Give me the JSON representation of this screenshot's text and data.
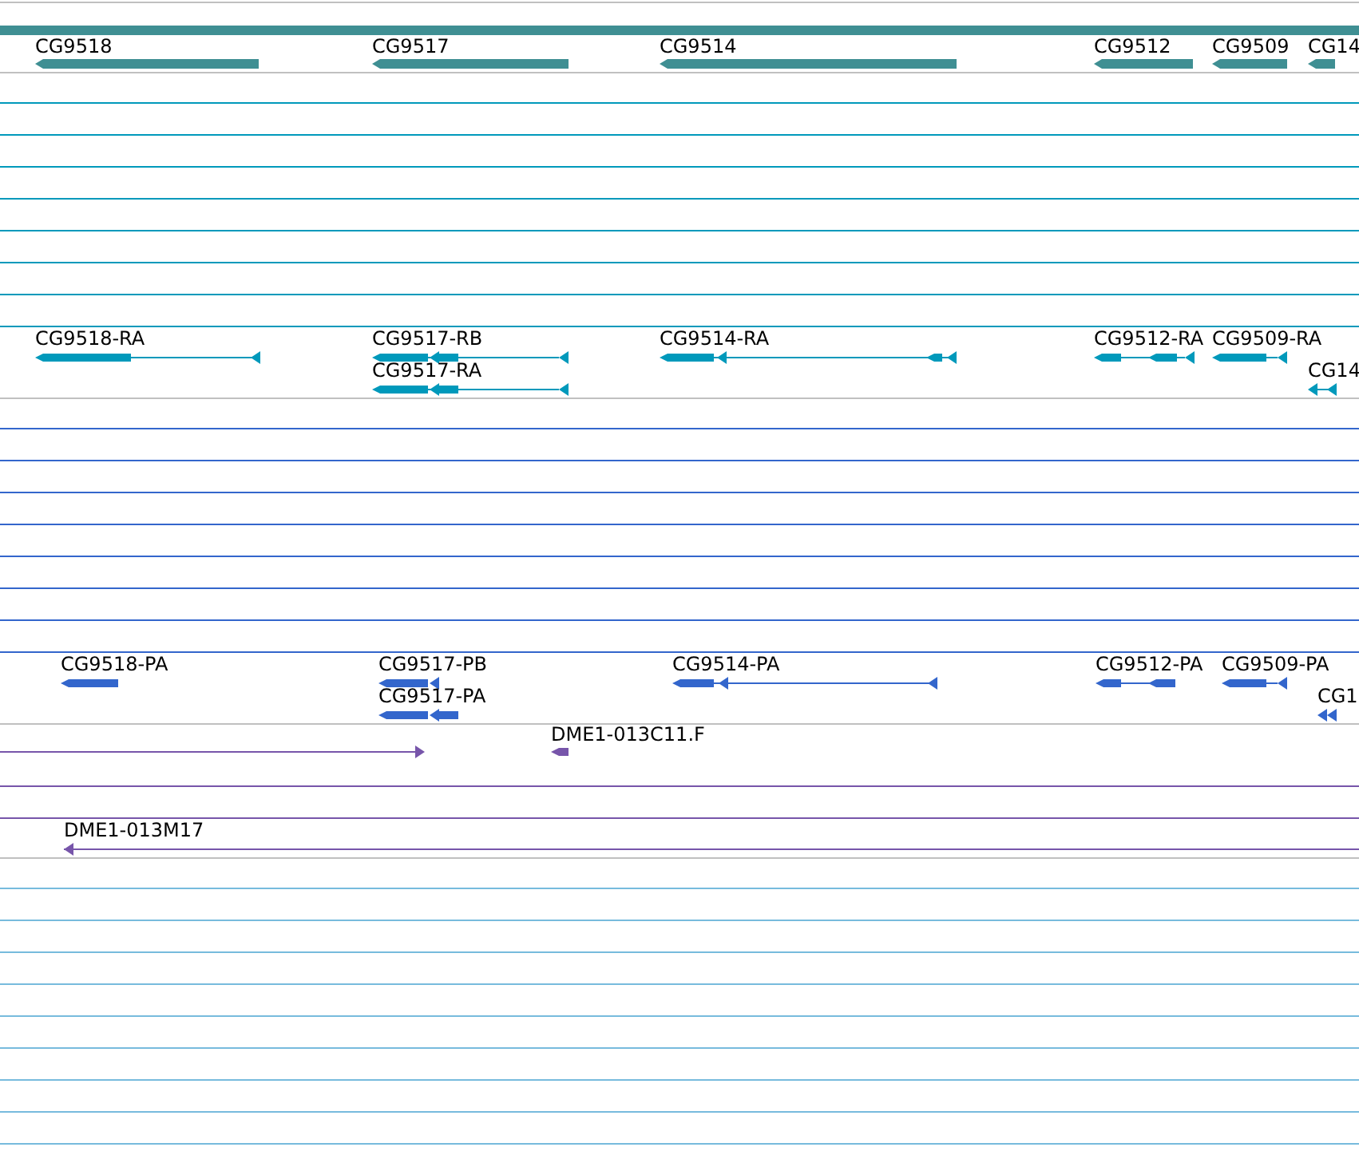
{
  "tracks": [
    {
      "color": "#3f8f93",
      "features": [
        {
          "label": "CG9518"
        },
        {
          "label": "CG9517"
        },
        {
          "label": "CG9514"
        },
        {
          "label": "CG9512"
        },
        {
          "label": "CG9509"
        },
        {
          "label": "CG14"
        }
      ]
    },
    {
      "color": "#0099bb",
      "features": [
        {
          "label": "CG9518-RA"
        },
        {
          "label": "CG9517-RB"
        },
        {
          "label": "CG9517-RA"
        },
        {
          "label": "CG9514-RA"
        },
        {
          "label": "CG9512-RA"
        },
        {
          "label": "CG9509-RA"
        },
        {
          "label": "CG14"
        }
      ]
    },
    {
      "color": "#3366cc",
      "features": [
        {
          "label": "CG9518-PA"
        },
        {
          "label": "CG9517-PB"
        },
        {
          "label": "CG9517-PA"
        },
        {
          "label": "CG9514-PA"
        },
        {
          "label": "CG9512-PA"
        },
        {
          "label": "CG9509-PA"
        },
        {
          "label": "CG1"
        }
      ]
    },
    {
      "color": "#7755aa",
      "features": [
        {
          "label": "DME1-013C11.F"
        },
        {
          "label": "DME1-013M17"
        }
      ]
    },
    {
      "color": "#77bbdd"
    }
  ]
}
